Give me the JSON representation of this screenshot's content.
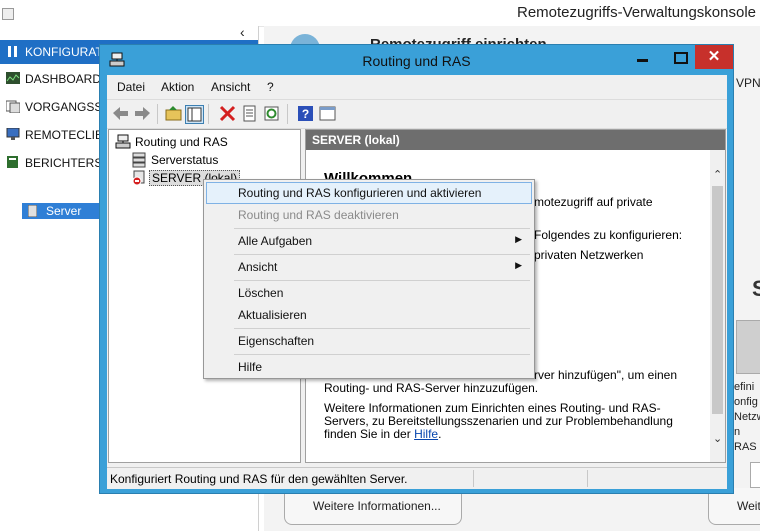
{
  "background_console": {
    "title": "Remotezugriffs-Verwaltungskonsole",
    "collapse_glyph": "‹",
    "nav_items": [
      {
        "label": "KONFIGURATI",
        "icon": "tools-icon",
        "selected": true
      },
      {
        "label": "DASHBOARD",
        "icon": "dashboard-icon"
      },
      {
        "label": "VORGANGSST",
        "icon": "operations-icon"
      },
      {
        "label": "REMOTECLIEN",
        "icon": "monitor-icon"
      },
      {
        "label": "BERICHTERSTE",
        "icon": "report-icon"
      }
    ],
    "server_item": "Server",
    "heading": "Remotezugriff einrichten",
    "vpn_fragment": "VPN.",
    "s_fragment": "S",
    "right_fragments": [
      "efini",
      "onfig",
      "Netzw",
      "n RAS"
    ],
    "more_info_1": "Weitere Informationen...",
    "more_info_2": "Weit"
  },
  "window": {
    "title": "Routing und RAS",
    "minimize": "minimize",
    "maximize": "maximize",
    "close": "✕",
    "menu": [
      "Datei",
      "Aktion",
      "Ansicht",
      "?"
    ],
    "toolbar_icons": [
      "back-arrow-icon",
      "forward-arrow-icon",
      "up-folder-icon",
      "show-hide-tree-icon",
      "delete-icon",
      "properties-icon",
      "refresh-icon",
      "help-icon",
      "console-view-icon"
    ],
    "tree": {
      "root": "Routing und RAS",
      "status": "Serverstatus",
      "server": "SERVER (lokal)"
    },
    "content": {
      "header": "SERVER (lokal)",
      "welcome": "Willkommen",
      "line1": "motezugriff auf private",
      "line2": "Folgendes zu konfigurieren:",
      "line3": "privaten Netzwerken",
      "line4": "rver hinzufügen\", um einen",
      "line5": "Routing- und RAS-Server hinzuzufügen.",
      "para2": "Weitere Informationen zum Einrichten eines Routing- und RAS-Servers, zu Bereitstellungsszenarien und zur Problembehandlung finden Sie in der",
      "link": "Hilfe",
      "para2_end": "."
    },
    "status_bar": "Konfiguriert Routing und RAS für den gewählten Server."
  },
  "context_menu": {
    "items": [
      {
        "label": "Routing und RAS konfigurieren und aktivieren",
        "state": "highlighted"
      },
      {
        "label": "Routing und RAS deaktivieren",
        "state": "disabled"
      },
      {
        "label": "Alle Aufgaben",
        "submenu": "▶"
      },
      {
        "label": "Ansicht",
        "submenu": "▶"
      },
      {
        "label": "Löschen"
      },
      {
        "label": "Aktualisieren"
      },
      {
        "label": "Eigenschaften"
      },
      {
        "label": "Hilfe"
      }
    ]
  },
  "colors": {
    "window_frame": "#3aa0d8",
    "close_button": "#c7302b",
    "nav_selected": "#1f6fc5",
    "menu_highlight": "#e5f1fb",
    "content_header": "#6e6e6e"
  }
}
